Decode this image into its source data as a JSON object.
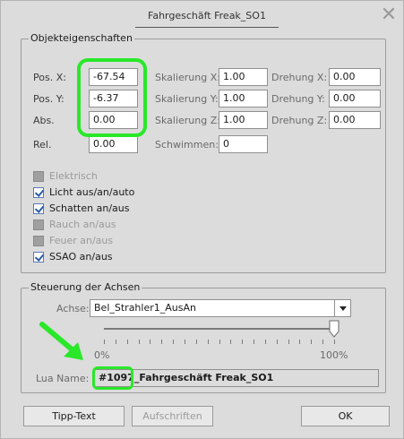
{
  "window": {
    "title": "Fahrgeschäft Freak_SO1"
  },
  "objekt": {
    "legend": "Objekteigenschaften",
    "rows": [
      {
        "pos_label": "Pos. X:",
        "pos_value": "-67.54",
        "scale_label": "Skalierung X:",
        "scale_value": "1.00",
        "rot_label": "Drehung X:",
        "rot_value": "0.00"
      },
      {
        "pos_label": "Pos. Y:",
        "pos_value": "-6.37",
        "scale_label": "Skalierung Y:",
        "scale_value": "1.00",
        "rot_label": "Drehung Y:",
        "rot_value": "0.00"
      },
      {
        "pos_label": "Abs.",
        "pos_value": "0.00",
        "scale_label": "Skalierung Z:",
        "scale_value": "1.00",
        "rot_label": "Drehung Z:",
        "rot_value": "0.00"
      }
    ],
    "rel_label": "Rel.",
    "rel_value": "0.00",
    "schwimmen_label": "Schwimmen:",
    "schwimmen_value": "0",
    "checkboxes": [
      {
        "label": "Elektrisch",
        "state": "disabled"
      },
      {
        "label": "Licht aus/an/auto",
        "state": "checked"
      },
      {
        "label": "Schatten an/aus",
        "state": "checked"
      },
      {
        "label": "Rauch an/aus",
        "state": "disabled"
      },
      {
        "label": "Feuer an/aus",
        "state": "disabled"
      },
      {
        "label": "SSAO an/aus",
        "state": "checked"
      }
    ]
  },
  "achsen": {
    "legend": "Steuerung der Achsen",
    "achse_label": "Achse:",
    "achse_value": "Bel_Strahler1_AusAn",
    "slider_min_label": "0%",
    "slider_max_label": "100%",
    "slider_value": 1.0,
    "lua_label": "Lua Name:",
    "lua_value": "#1097_Fahrgeschäft Freak_SO1"
  },
  "buttons": {
    "tipp": "Tipp-Text",
    "aufschriften": "Aufschriften",
    "ok": "OK"
  },
  "colors": {
    "highlight": "#29e829",
    "dialog_bg": "#dcdcdc"
  }
}
